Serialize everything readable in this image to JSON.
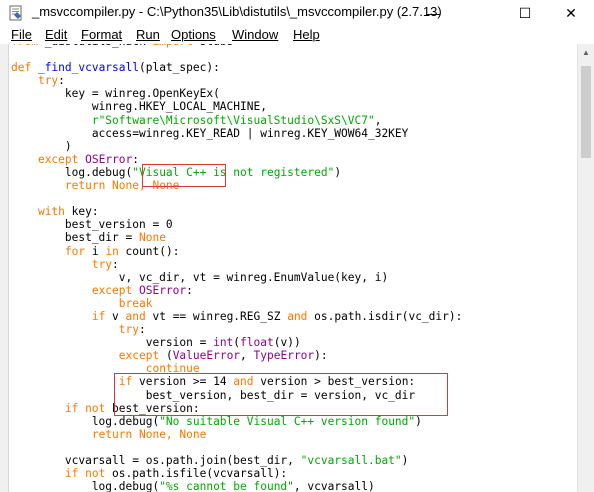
{
  "window": {
    "title": "_msvccompiler.py - C:\\Python35\\Lib\\distutils\\_msvccompiler.py (2.7.13)",
    "minimize_glyph": "—",
    "maximize_glyph": "☐",
    "close_glyph": "✕"
  },
  "menu": {
    "items": [
      "File",
      "Edit",
      "Format",
      "Run",
      "Options",
      "Window",
      "Help"
    ]
  },
  "editor": {
    "code_lines": [
      [
        [
          "from ",
          "kw"
        ],
        [
          "_distutils_hack",
          ""
        ],
        [
          " import ",
          "kw"
        ],
        [
          "stubs",
          ""
        ]
      ],
      [],
      [
        [
          "def ",
          "kw"
        ],
        [
          "_find_vcvarsall",
          "fn"
        ],
        [
          "(plat_spec):",
          ""
        ]
      ],
      [
        [
          "    ",
          ""
        ],
        [
          "try",
          "kw"
        ],
        [
          ":",
          ""
        ]
      ],
      [
        [
          "        key = winreg.OpenKeyEx(",
          ""
        ]
      ],
      [
        [
          "            winreg.HKEY_LOCAL_MACHINE,",
          ""
        ]
      ],
      [
        [
          "            ",
          ""
        ],
        [
          "r\"Software\\Microsoft\\VisualStudio\\SxS\\VC7\"",
          "st"
        ],
        [
          ",",
          ""
        ]
      ],
      [
        [
          "            access=winreg.KEY_READ | winreg.KEY_WOW64_32KEY",
          ""
        ]
      ],
      [
        [
          "        )",
          ""
        ]
      ],
      [
        [
          "    ",
          ""
        ],
        [
          "except ",
          "kw"
        ],
        [
          "OSError",
          "bi"
        ],
        [
          ":",
          ""
        ]
      ],
      [
        [
          "        log.debug(",
          ""
        ],
        [
          "\"Visual C++ is not registered\"",
          "st"
        ],
        [
          ")",
          ""
        ]
      ],
      [
        [
          "        ",
          ""
        ],
        [
          "return ",
          "kw"
        ],
        [
          "None, None",
          "kw"
        ]
      ],
      [],
      [
        [
          "    ",
          ""
        ],
        [
          "with ",
          "kw"
        ],
        [
          "key:",
          ""
        ]
      ],
      [
        [
          "        best_version = 0",
          ""
        ]
      ],
      [
        [
          "        best_dir = ",
          ""
        ],
        [
          "None",
          "kw"
        ]
      ],
      [
        [
          "        ",
          ""
        ],
        [
          "for ",
          "kw"
        ],
        [
          "i ",
          ""
        ],
        [
          "in ",
          "kw"
        ],
        [
          "count():",
          ""
        ]
      ],
      [
        [
          "            ",
          ""
        ],
        [
          "try",
          "kw"
        ],
        [
          ":",
          ""
        ]
      ],
      [
        [
          "                v, vc_dir, vt = winreg.EnumValue(key, i)",
          ""
        ]
      ],
      [
        [
          "            ",
          ""
        ],
        [
          "except ",
          "kw"
        ],
        [
          "OSError",
          "bi"
        ],
        [
          ":",
          ""
        ]
      ],
      [
        [
          "                ",
          ""
        ],
        [
          "break",
          "kw"
        ]
      ],
      [
        [
          "            ",
          ""
        ],
        [
          "if ",
          "kw"
        ],
        [
          "v ",
          ""
        ],
        [
          "and ",
          "kw"
        ],
        [
          "vt == winreg.REG_SZ ",
          ""
        ],
        [
          "and ",
          "kw"
        ],
        [
          "os.path.isdir(vc_dir):",
          ""
        ]
      ],
      [
        [
          "                ",
          ""
        ],
        [
          "try",
          "kw"
        ],
        [
          ":",
          ""
        ]
      ],
      [
        [
          "                    version = ",
          ""
        ],
        [
          "int",
          "bi"
        ],
        [
          "(",
          ""
        ],
        [
          "float",
          "bi"
        ],
        [
          "(v))",
          ""
        ]
      ],
      [
        [
          "                ",
          ""
        ],
        [
          "except ",
          "kw"
        ],
        [
          "(",
          ""
        ],
        [
          "ValueError",
          "bi"
        ],
        [
          ", ",
          ""
        ],
        [
          "TypeError",
          "bi"
        ],
        [
          "):",
          ""
        ]
      ],
      [
        [
          "                    ",
          ""
        ],
        [
          "continue",
          "kw"
        ]
      ],
      [
        [
          "                ",
          ""
        ],
        [
          "if ",
          "kw"
        ],
        [
          "version >= 14 ",
          ""
        ],
        [
          "and ",
          "kw"
        ],
        [
          "version > best_version:",
          ""
        ]
      ],
      [
        [
          "                    best_version, best_dir = version, vc_dir",
          ""
        ]
      ],
      [
        [
          "        ",
          ""
        ],
        [
          "if not ",
          "kw"
        ],
        [
          "best_version:",
          ""
        ]
      ],
      [
        [
          "            log.debug(",
          ""
        ],
        [
          "\"No suitable Visual C++ version found\"",
          "st"
        ],
        [
          ")",
          ""
        ]
      ],
      [
        [
          "            ",
          ""
        ],
        [
          "return ",
          "kw"
        ],
        [
          "None, None",
          "kw"
        ]
      ],
      [],
      [
        [
          "        vcvarsall = os.path.join(best_dir, ",
          ""
        ],
        [
          "\"vcvarsall.bat\"",
          "st"
        ],
        [
          ")",
          ""
        ]
      ],
      [
        [
          "        ",
          ""
        ],
        [
          "if not ",
          "kw"
        ],
        [
          "os.path.isfile(vcvarsall):",
          ""
        ]
      ],
      [
        [
          "            log.debug(",
          ""
        ],
        [
          "\"%s cannot be found\"",
          "st"
        ],
        [
          ", vcvarsall)",
          ""
        ]
      ]
    ]
  },
  "colors": {
    "keyword": "#ff7700",
    "builtin": "#900090",
    "string": "#00aa00",
    "function_name": "#0000ff",
    "highlight_box": "#d83a3a"
  }
}
